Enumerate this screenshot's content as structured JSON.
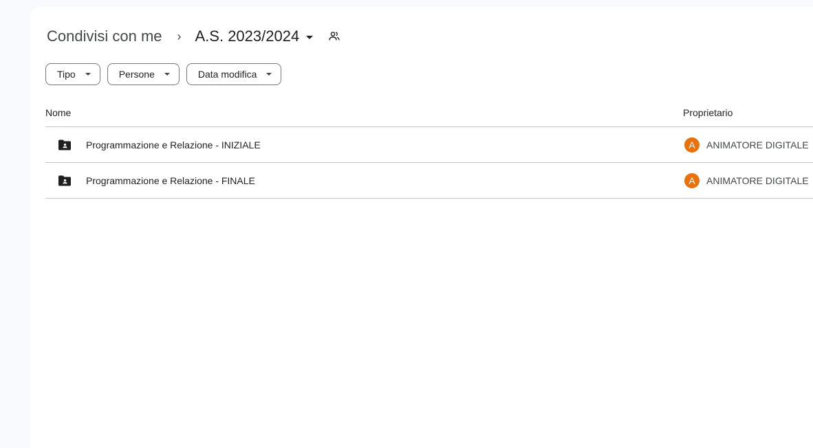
{
  "breadcrumb": {
    "root": "Condivisi con me",
    "separator": "›",
    "current": "A.S. 2023/2024",
    "current_icon": "shared-folder-people-icon"
  },
  "filters": [
    {
      "label": "Tipo",
      "icon": "chevron-down-icon"
    },
    {
      "label": "Persone",
      "icon": "chevron-down-icon"
    },
    {
      "label": "Data modifica",
      "icon": "chevron-down-icon"
    }
  ],
  "table": {
    "columns": {
      "name": "Nome",
      "owner": "Proprietario"
    },
    "rows": [
      {
        "icon": "shared-folder-icon",
        "name": "Programmazione e Relazione - INIZIALE",
        "owner_initial": "A",
        "owner": "ANIMATORE DIGITALE"
      },
      {
        "icon": "shared-folder-icon",
        "name": "Programmazione e Relazione - FINALE",
        "owner_initial": "A",
        "owner": "ANIMATORE DIGITALE"
      }
    ]
  },
  "colors": {
    "avatar": "#e8710a",
    "background": "#f8fafd",
    "panel": "#ffffff",
    "divider": "#c7c7c7",
    "chip_border": "#747775"
  }
}
